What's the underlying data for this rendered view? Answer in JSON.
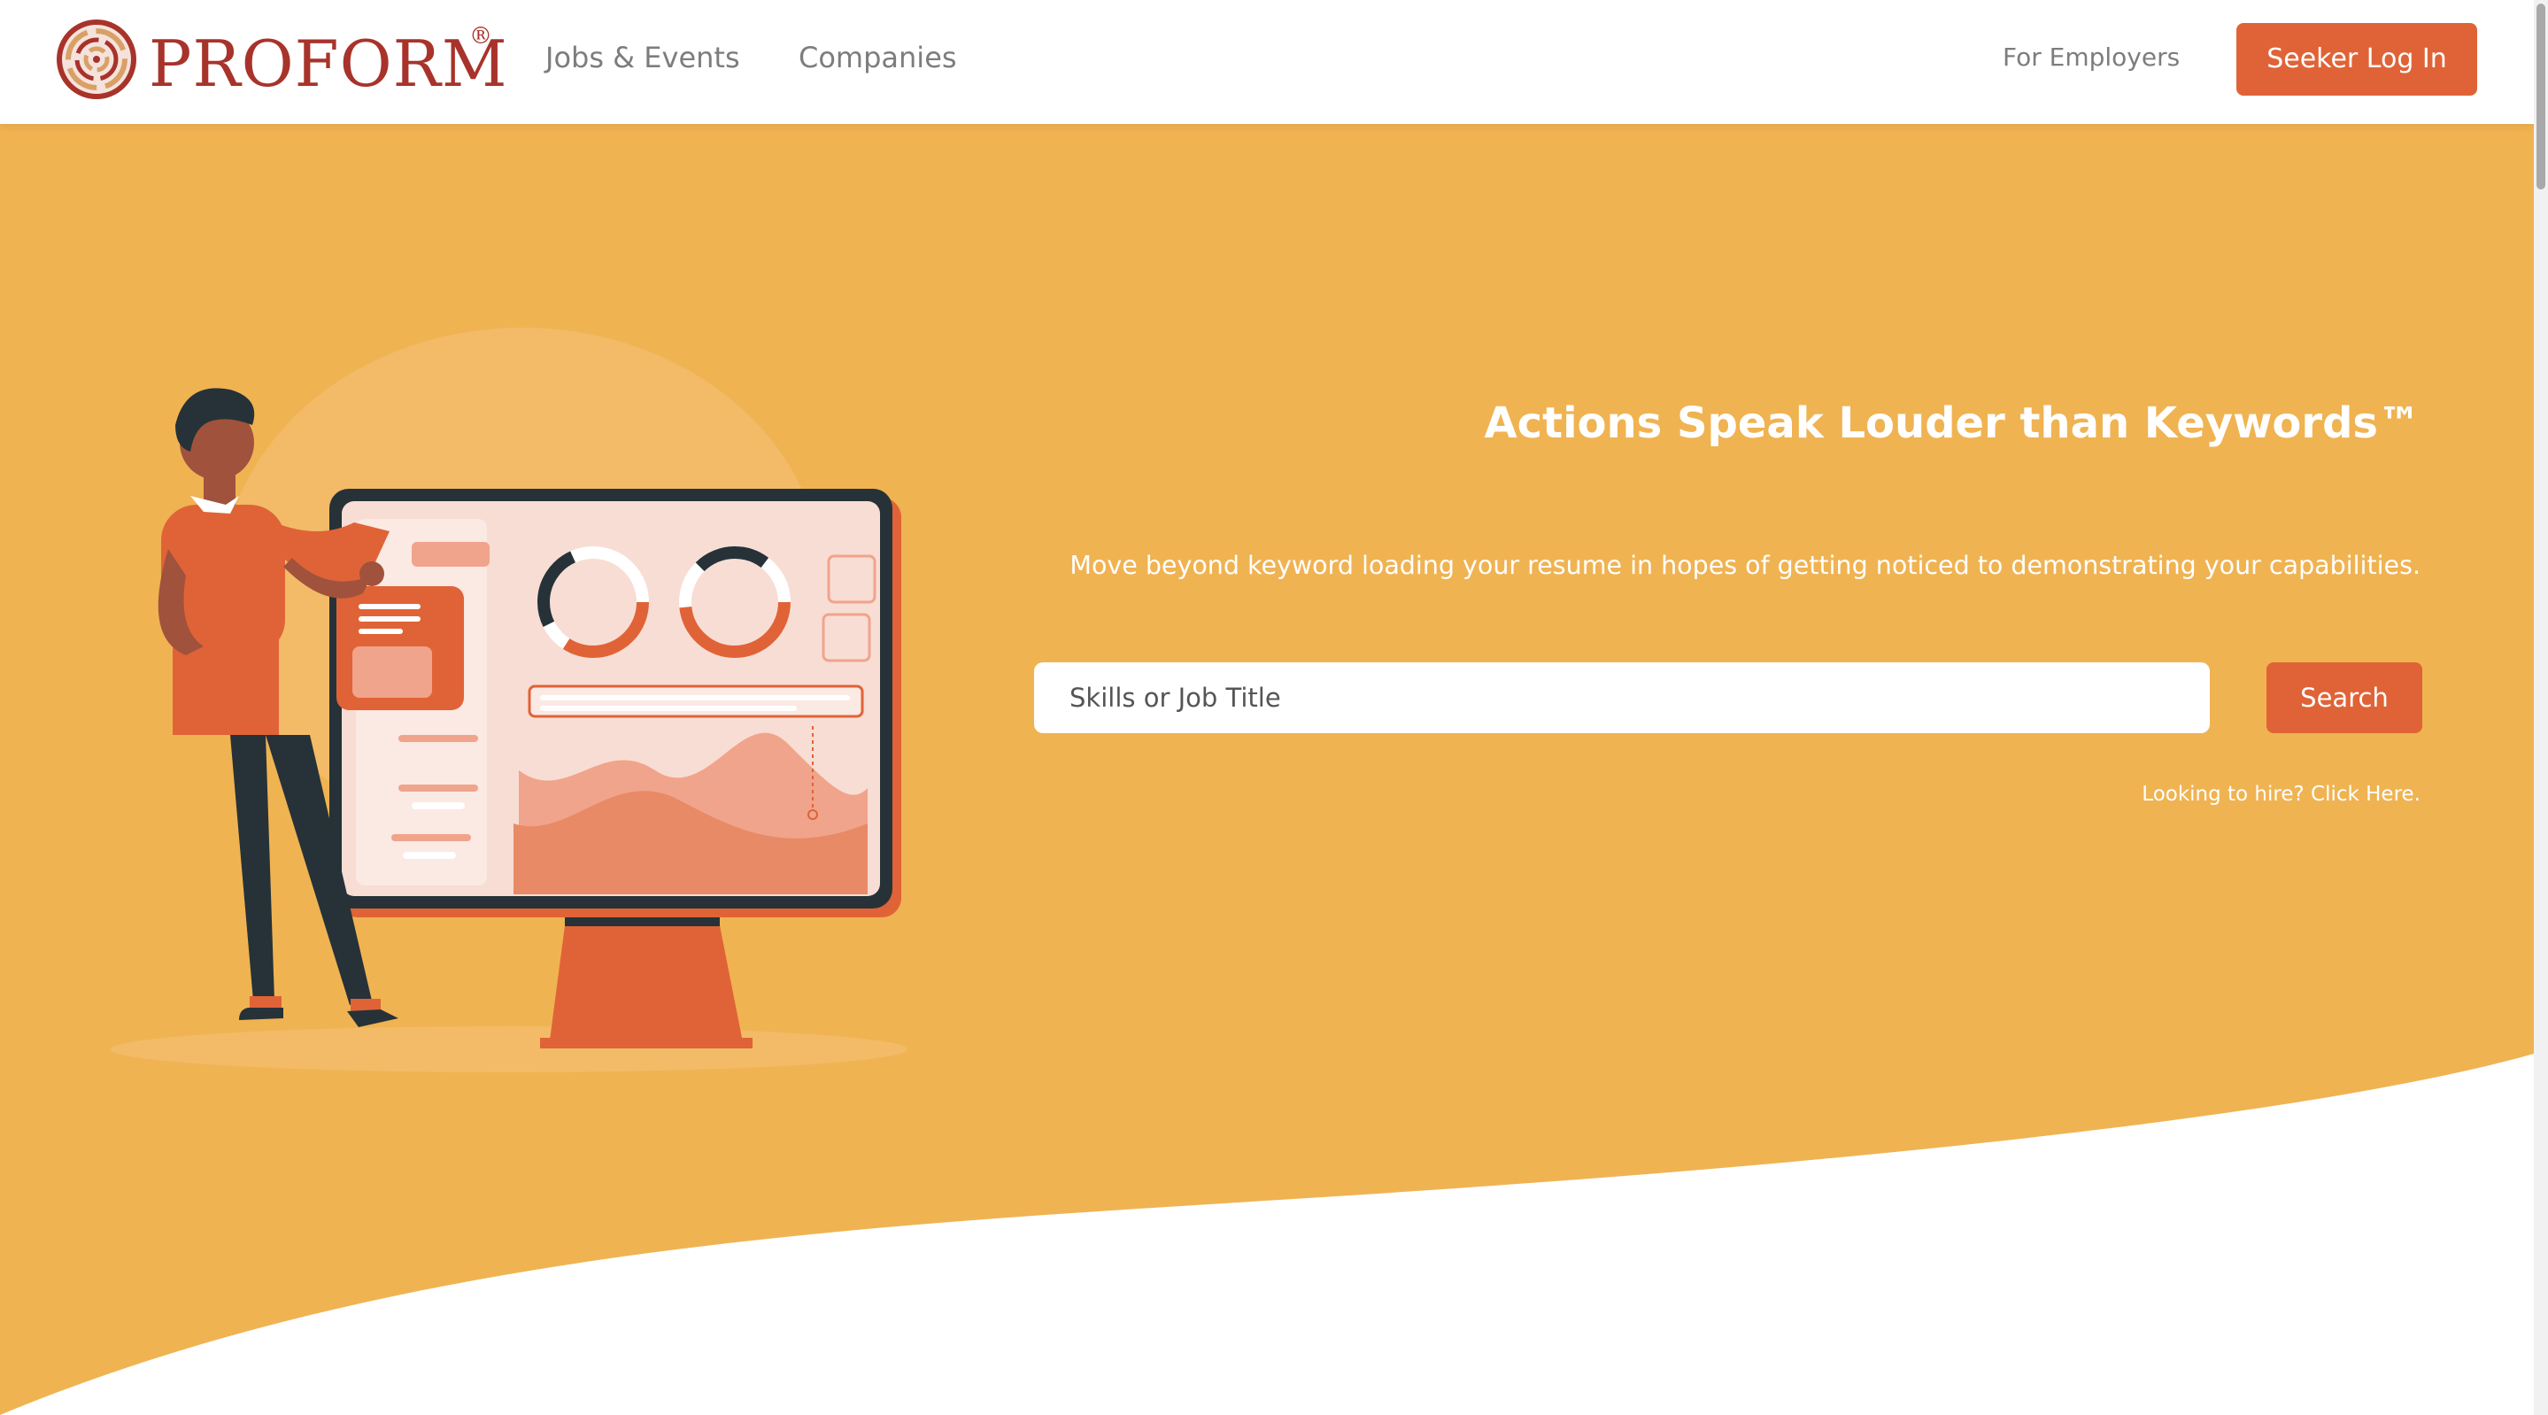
{
  "nav": {
    "brand": "PROFORM",
    "brand_mark": "®",
    "logo_icon": "maze-target-icon",
    "links": [
      {
        "label": "Jobs & Events"
      },
      {
        "label": "Companies"
      }
    ],
    "employers_label": "For Employers",
    "login_label": "Seeker Log In"
  },
  "hero": {
    "title": "Actions Speak Louder than Keywords™",
    "subtitle": "Move beyond keyword loading your resume in hopes of getting noticed to demonstrating your capabilities.",
    "search": {
      "placeholder": "Skills or Job Title",
      "value": "",
      "button_label": "Search"
    },
    "hire_link": "Looking to hire? Click Here."
  },
  "colors": {
    "accent": "#e06337",
    "hero_background": "#f0b352",
    "brand": "#a8332b"
  }
}
